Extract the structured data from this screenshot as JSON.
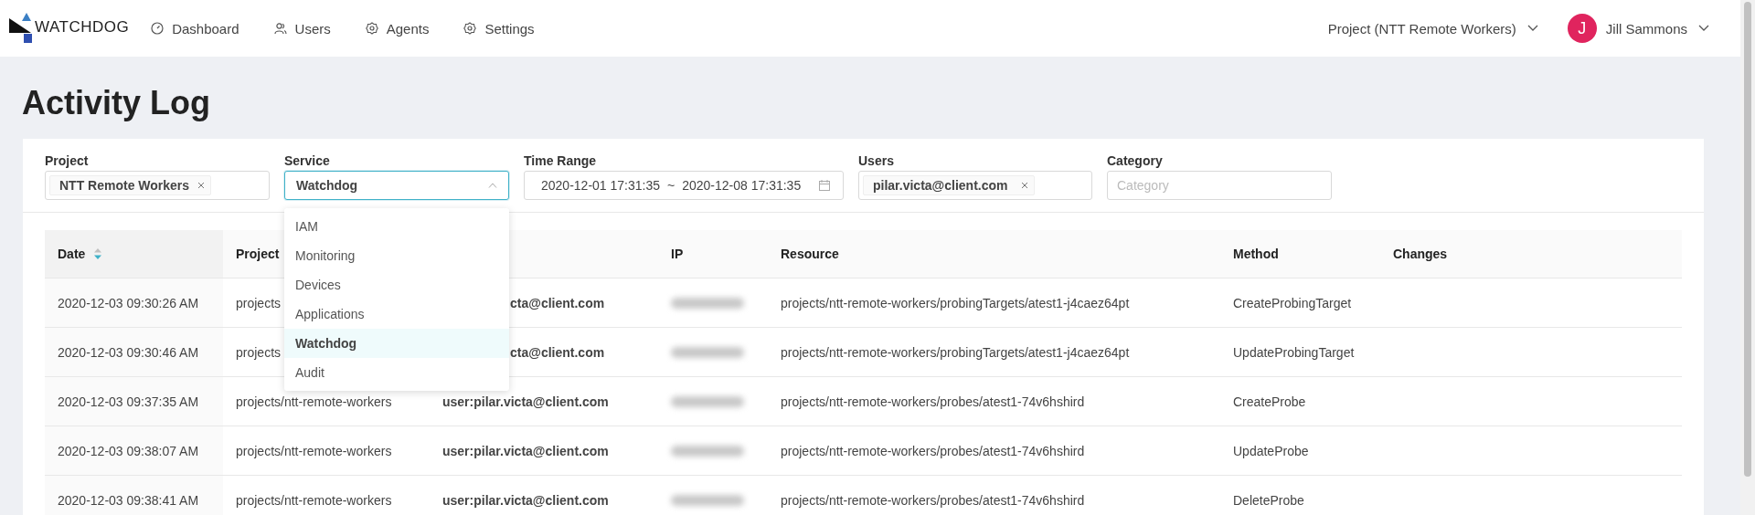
{
  "nav": {
    "logo": "WATCHDOG",
    "items": [
      {
        "label": "Dashboard",
        "selected": false
      },
      {
        "label": "Users",
        "selected": false
      },
      {
        "label": "Agents",
        "selected": false
      },
      {
        "label": "Settings",
        "selected": false
      }
    ]
  },
  "header_right": {
    "project": "Project (NTT Remote Workers)",
    "user": {
      "initial": "J",
      "name": "Jill Sammons"
    }
  },
  "page_title": "Activity Log",
  "filters": [
    {
      "kind": "tags",
      "label": "Project",
      "tags": [
        "NTT Remote Workers"
      ]
    },
    {
      "kind": "select",
      "label": "Service",
      "value": "Watchdog",
      "expanded": true,
      "options": [
        {
          "label": "IAM",
          "selected": false
        },
        {
          "label": "Monitoring",
          "selected": false
        },
        {
          "label": "Devices",
          "selected": false
        },
        {
          "label": "Applications",
          "selected": false
        },
        {
          "label": "Watchdog",
          "selected": true
        },
        {
          "label": "Audit",
          "selected": false
        }
      ]
    },
    {
      "kind": "range",
      "label": "Time Range",
      "start": "2020-12-01 17:31:35",
      "separator": "~",
      "end": "2020-12-08 17:31:35"
    },
    {
      "kind": "tags",
      "label": "Users",
      "tags": [
        "pilar.victa@client.com"
      ]
    },
    {
      "kind": "input",
      "label": "Category",
      "placeholder": "Category"
    }
  ],
  "table": {
    "columns": [
      {
        "label": "Date",
        "sortable": true
      },
      {
        "label": "Project"
      },
      {},
      {
        "label": "IP"
      },
      {
        "label": "Resource"
      },
      {
        "label": "Method"
      },
      {
        "label": "Changes"
      }
    ],
    "rows": [
      {
        "date": "2020-12-03 09:30:26 AM",
        "project": "projects",
        "user": "cta@client.com",
        "covered_by_menu": true,
        "resource": "projects/ntt-remote-workers/probingTargets/atest1-j4caez64pt",
        "method": "CreateProbingTarget"
      },
      {
        "date": "2020-12-03 09:30:46 AM",
        "project": "projects",
        "user": "cta@client.com",
        "covered_by_menu": true,
        "resource": "projects/ntt-remote-workers/probingTargets/atest1-j4caez64pt",
        "method": "UpdateProbingTarget"
      },
      {
        "date": "2020-12-03 09:37:35 AM",
        "project": "projects/ntt-remote-workers",
        "user": "user:pilar.victa@client.com",
        "covered_by_menu": false,
        "resource": "projects/ntt-remote-workers/probes/atest1-74v6hshird",
        "method": "CreateProbe"
      },
      {
        "date": "2020-12-03 09:38:07 AM",
        "project": "projects/ntt-remote-workers",
        "user": "user:pilar.victa@client.com",
        "covered_by_menu": false,
        "resource": "projects/ntt-remote-workers/probes/atest1-74v6hshird",
        "method": "UpdateProbe"
      },
      {
        "date": "2020-12-03 09:38:41 AM",
        "project": "projects/ntt-remote-workers",
        "user": "user:pilar.victa@client.com",
        "covered_by_menu": false,
        "resource": "projects/ntt-remote-workers/probes/atest1-74v6hshird",
        "method": "DeleteProbe"
      }
    ]
  }
}
